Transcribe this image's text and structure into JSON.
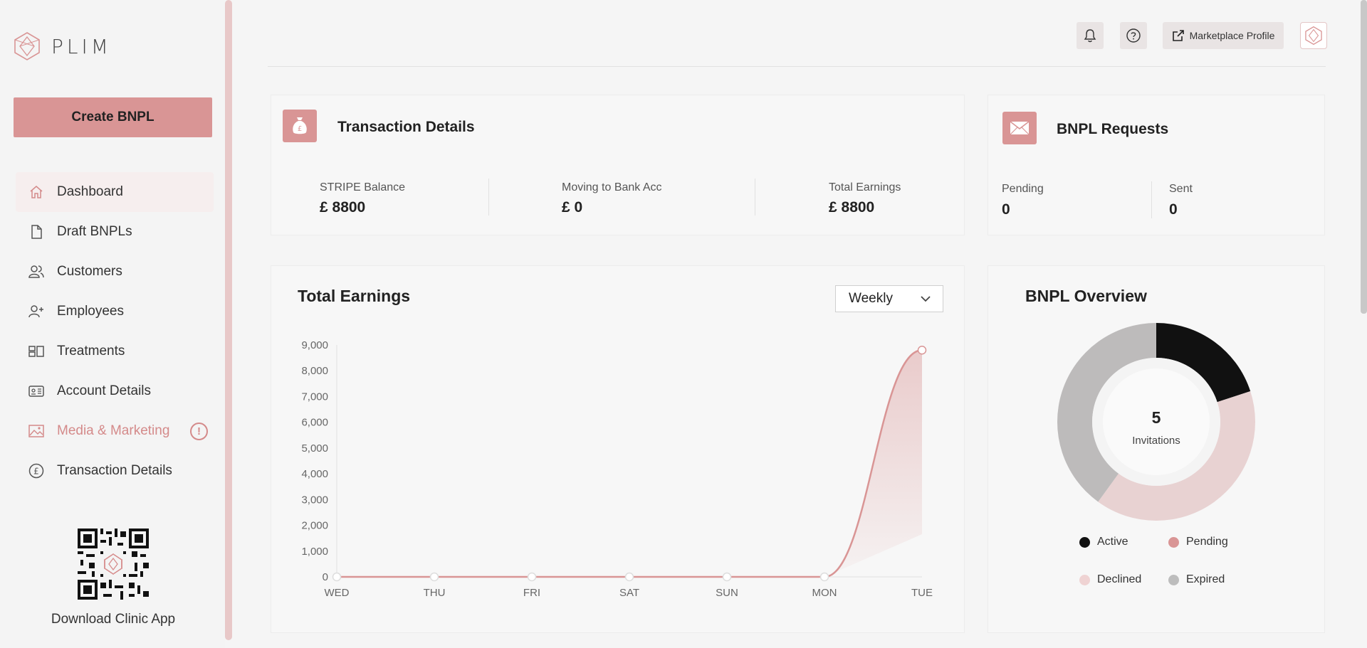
{
  "app": {
    "logo_text": "PLIM"
  },
  "sidebar": {
    "create_button": "Create BNPL",
    "items": [
      {
        "label": "Dashboard",
        "icon": "home-icon"
      },
      {
        "label": "Draft BNPLs",
        "icon": "document-icon"
      },
      {
        "label": "Customers",
        "icon": "users-icon"
      },
      {
        "label": "Employees",
        "icon": "user-plus-icon"
      },
      {
        "label": "Treatments",
        "icon": "treatments-icon"
      },
      {
        "label": "Account Details",
        "icon": "id-card-icon"
      },
      {
        "label": "Media & Marketing",
        "icon": "image-icon"
      },
      {
        "label": "Transaction Details",
        "icon": "pound-circle-icon"
      }
    ],
    "warning_glyph": "!",
    "qr_caption": "Download Clinic App"
  },
  "topbar": {
    "marketplace_label": "Marketplace Profile"
  },
  "transaction_card": {
    "title": "Transaction Details",
    "stats": [
      {
        "label": "STRIPE Balance",
        "value": "£ 8800"
      },
      {
        "label": "Moving to Bank Acc",
        "value": "£ 0"
      },
      {
        "label": "Total Earnings",
        "value": "£ 8800"
      }
    ]
  },
  "requests_card": {
    "title": "BNPL Requests",
    "stats": [
      {
        "label": "Pending",
        "value": "0"
      },
      {
        "label": "Sent",
        "value": "0"
      }
    ]
  },
  "earnings_card": {
    "title": "Total Earnings",
    "period_selected": "Weekly"
  },
  "chart_data": [
    {
      "type": "area",
      "title": "Total Earnings",
      "x": [
        "WED",
        "THU",
        "FRI",
        "SAT",
        "SUN",
        "MON",
        "TUE"
      ],
      "values": [
        0,
        0,
        0,
        0,
        0,
        0,
        8800
      ],
      "ylim": [
        0,
        9000
      ],
      "yticks": [
        "0",
        "1,000",
        "2,000",
        "3,000",
        "4,000",
        "5,000",
        "6,000",
        "7,000",
        "8,000",
        "9,000"
      ],
      "color": "#d99595"
    },
    {
      "type": "pie",
      "title": "BNPL Overview",
      "center_value": "5",
      "center_label": "Invitations",
      "slices": [
        {
          "name": "Active",
          "value": 1,
          "color": "#111111"
        },
        {
          "name": "Pending",
          "value": 2,
          "color": "#e8d2d2"
        },
        {
          "name": "Expired",
          "value": 2,
          "color": "#bdbbbb"
        }
      ],
      "legend": [
        {
          "name": "Active",
          "color": "#111111"
        },
        {
          "name": "Pending",
          "color": "#d99595"
        },
        {
          "name": "Declined",
          "color": "#efd3d3"
        },
        {
          "name": "Expired",
          "color": "#bdbdbd"
        }
      ]
    }
  ]
}
